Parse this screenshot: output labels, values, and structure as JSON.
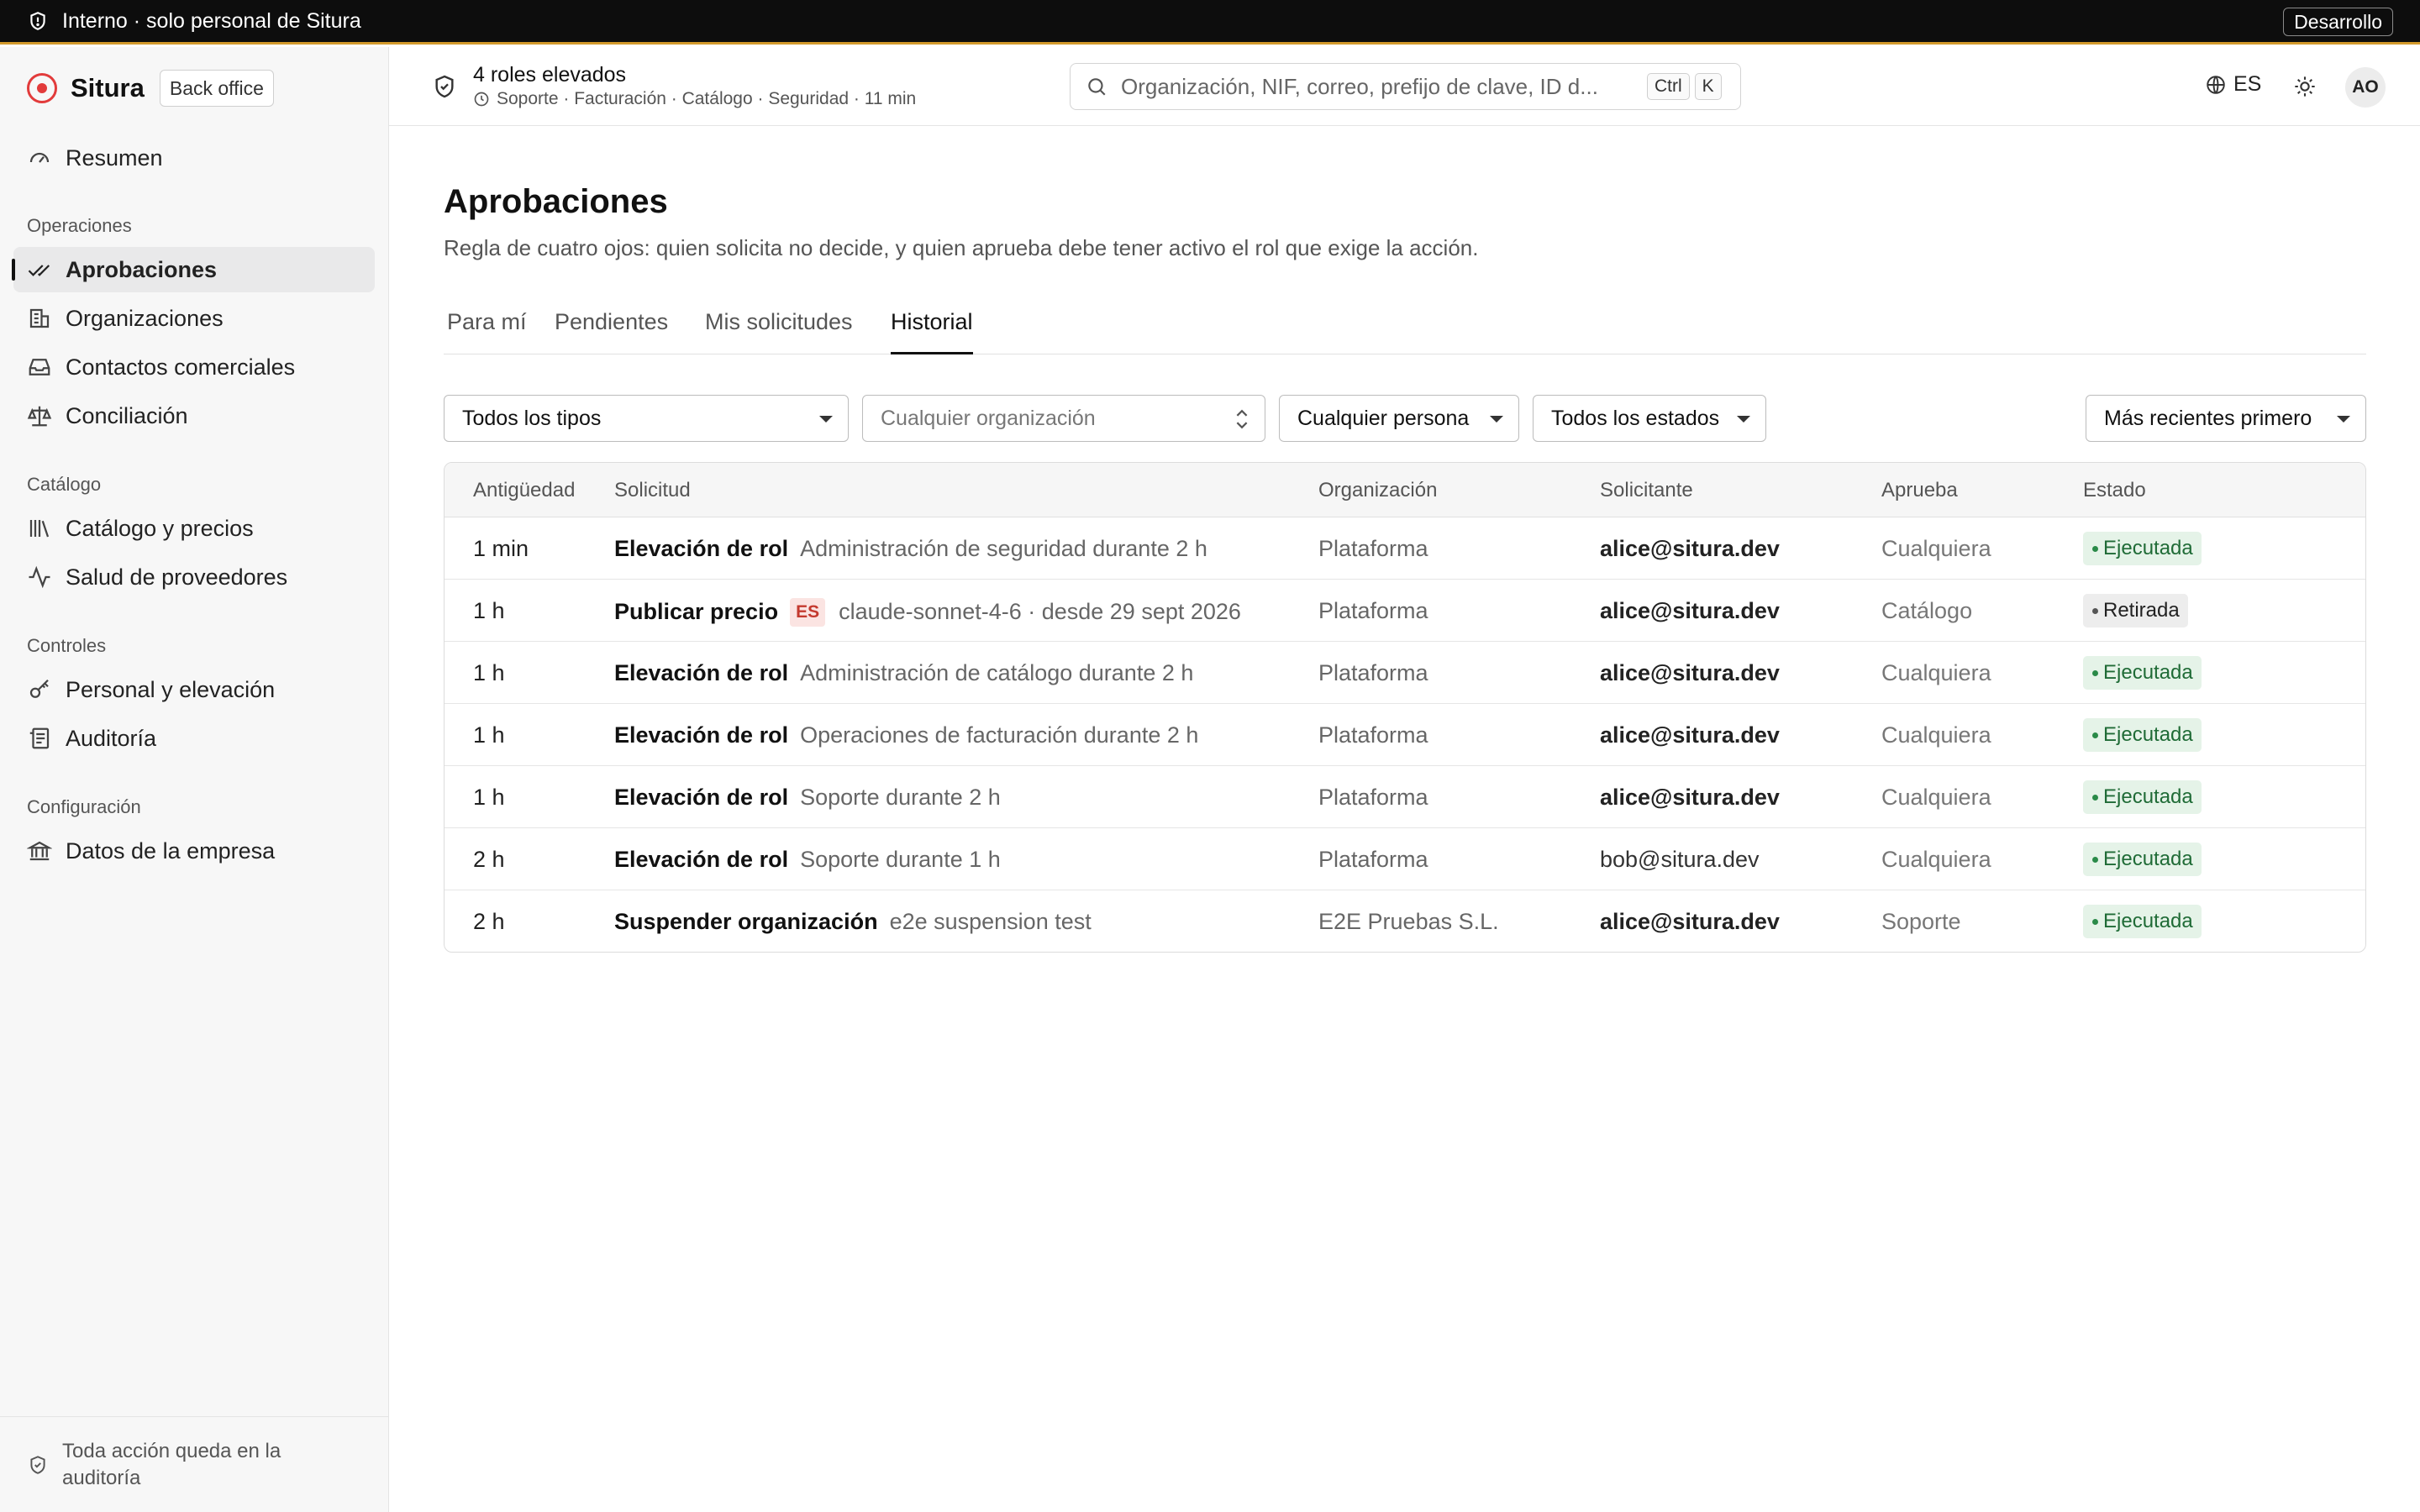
{
  "banner": {
    "text": "Interno · solo personal de Situra",
    "env": "Desarrollo"
  },
  "brand": {
    "name": "Situra",
    "badge": "Back office"
  },
  "nav": {
    "summary": "Resumen",
    "sections": [
      {
        "title": "Operaciones",
        "items": [
          "Aprobaciones",
          "Organizaciones",
          "Contactos comerciales",
          "Conciliación"
        ]
      },
      {
        "title": "Catálogo",
        "items": [
          "Catálogo y precios",
          "Salud de proveedores"
        ]
      },
      {
        "title": "Controles",
        "items": [
          "Personal y elevación",
          "Auditoría"
        ]
      },
      {
        "title": "Configuración",
        "items": [
          "Datos de la empresa"
        ]
      }
    ],
    "active": "Aprobaciones",
    "footer": "Toda acción queda en la auditoría"
  },
  "header": {
    "roles_title": "4 roles elevados",
    "roles_detail": "Soporte · Facturación · Catálogo · Seguridad · 11 min",
    "search_placeholder": "Organización, NIF, correo, prefijo de clave, ID d...",
    "kbd_ctrl": "Ctrl",
    "kbd_k": "K",
    "lang": "ES",
    "avatar": "AO"
  },
  "page": {
    "title": "Aprobaciones",
    "subtitle": "Regla de cuatro ojos: quien solicita no decide, y quien aprueba debe tener activo el rol que exige la acción.",
    "tabs": [
      "Para mí",
      "Pendientes",
      "Mis solicitudes",
      "Historial"
    ],
    "active_tab": "Historial"
  },
  "filters": {
    "type": "Todos los tipos",
    "org_placeholder": "Cualquier organización",
    "person": "Cualquier persona",
    "status": "Todos los estados",
    "sort": "Más recientes primero"
  },
  "table": {
    "headers": [
      "Antigüedad",
      "Solicitud",
      "Organización",
      "Solicitante",
      "Aprueba",
      "Estado"
    ],
    "rows": [
      {
        "age": "1 min",
        "type": "Elevación de rol",
        "tag": "",
        "detail": "Administración de seguridad durante 2 h",
        "org": "Plataforma",
        "requester": "alice@situra.dev",
        "approver": "Cualquiera",
        "status": "Ejecutada"
      },
      {
        "age": "1 h",
        "type": "Publicar precio",
        "tag": "ES",
        "detail": "claude-sonnet-4-6 · desde 29 sept 2026",
        "org": "Plataforma",
        "requester": "alice@situra.dev",
        "approver": "Catálogo",
        "status": "Retirada"
      },
      {
        "age": "1 h",
        "type": "Elevación de rol",
        "tag": "",
        "detail": "Administración de catálogo durante 2 h",
        "org": "Plataforma",
        "requester": "alice@situra.dev",
        "approver": "Cualquiera",
        "status": "Ejecutada"
      },
      {
        "age": "1 h",
        "type": "Elevación de rol",
        "tag": "",
        "detail": "Operaciones de facturación durante 2 h",
        "org": "Plataforma",
        "requester": "alice@situra.dev",
        "approver": "Cualquiera",
        "status": "Ejecutada"
      },
      {
        "age": "1 h",
        "type": "Elevación de rol",
        "tag": "",
        "detail": "Soporte durante 2 h",
        "org": "Plataforma",
        "requester": "alice@situra.dev",
        "approver": "Cualquiera",
        "status": "Ejecutada"
      },
      {
        "age": "2 h",
        "type": "Elevación de rol",
        "tag": "",
        "detail": "Soporte durante 1 h",
        "org": "Plataforma",
        "requester": "bob@situra.dev",
        "approver": "Cualquiera",
        "status": "Ejecutada"
      },
      {
        "age": "2 h",
        "type": "Suspender organización",
        "tag": "",
        "detail": "e2e suspension test",
        "org": "E2E Pruebas S.L.",
        "requester": "alice@situra.dev",
        "approver": "Soporte",
        "status": "Ejecutada"
      }
    ]
  },
  "colors": {
    "accent_bar": "#d39a2c",
    "brand": "#e23b3b",
    "status_ok": "#1f6b36",
    "status_ok_bg": "#e5f3e8"
  }
}
